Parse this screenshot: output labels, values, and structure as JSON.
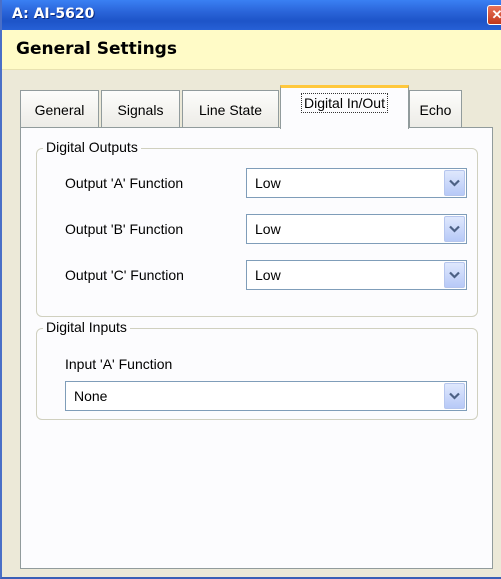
{
  "window": {
    "title": "A: AI-5620",
    "close_glyph": "✕"
  },
  "header": {
    "heading": "General Settings"
  },
  "tabs": [
    {
      "label": "General"
    },
    {
      "label": "Signals"
    },
    {
      "label": "Line State"
    },
    {
      "label": "Digital In/Out",
      "active": true
    },
    {
      "label": "Echo"
    }
  ],
  "digital_outputs": {
    "legend": "Digital Outputs",
    "fields": [
      {
        "label": "Output 'A' Function",
        "value": "Low"
      },
      {
        "label": "Output 'B' Function",
        "value": "Low"
      },
      {
        "label": "Output 'C' Function",
        "value": "Low"
      }
    ]
  },
  "digital_inputs": {
    "legend": "Digital Inputs",
    "fields": [
      {
        "label": "Input 'A' Function",
        "value": "None"
      }
    ]
  },
  "colors": {
    "titlebar": "#2a64d9",
    "header_band": "#fffbc7",
    "active_tab_accent": "#ffc83c",
    "select_border": "#7f9db9"
  }
}
